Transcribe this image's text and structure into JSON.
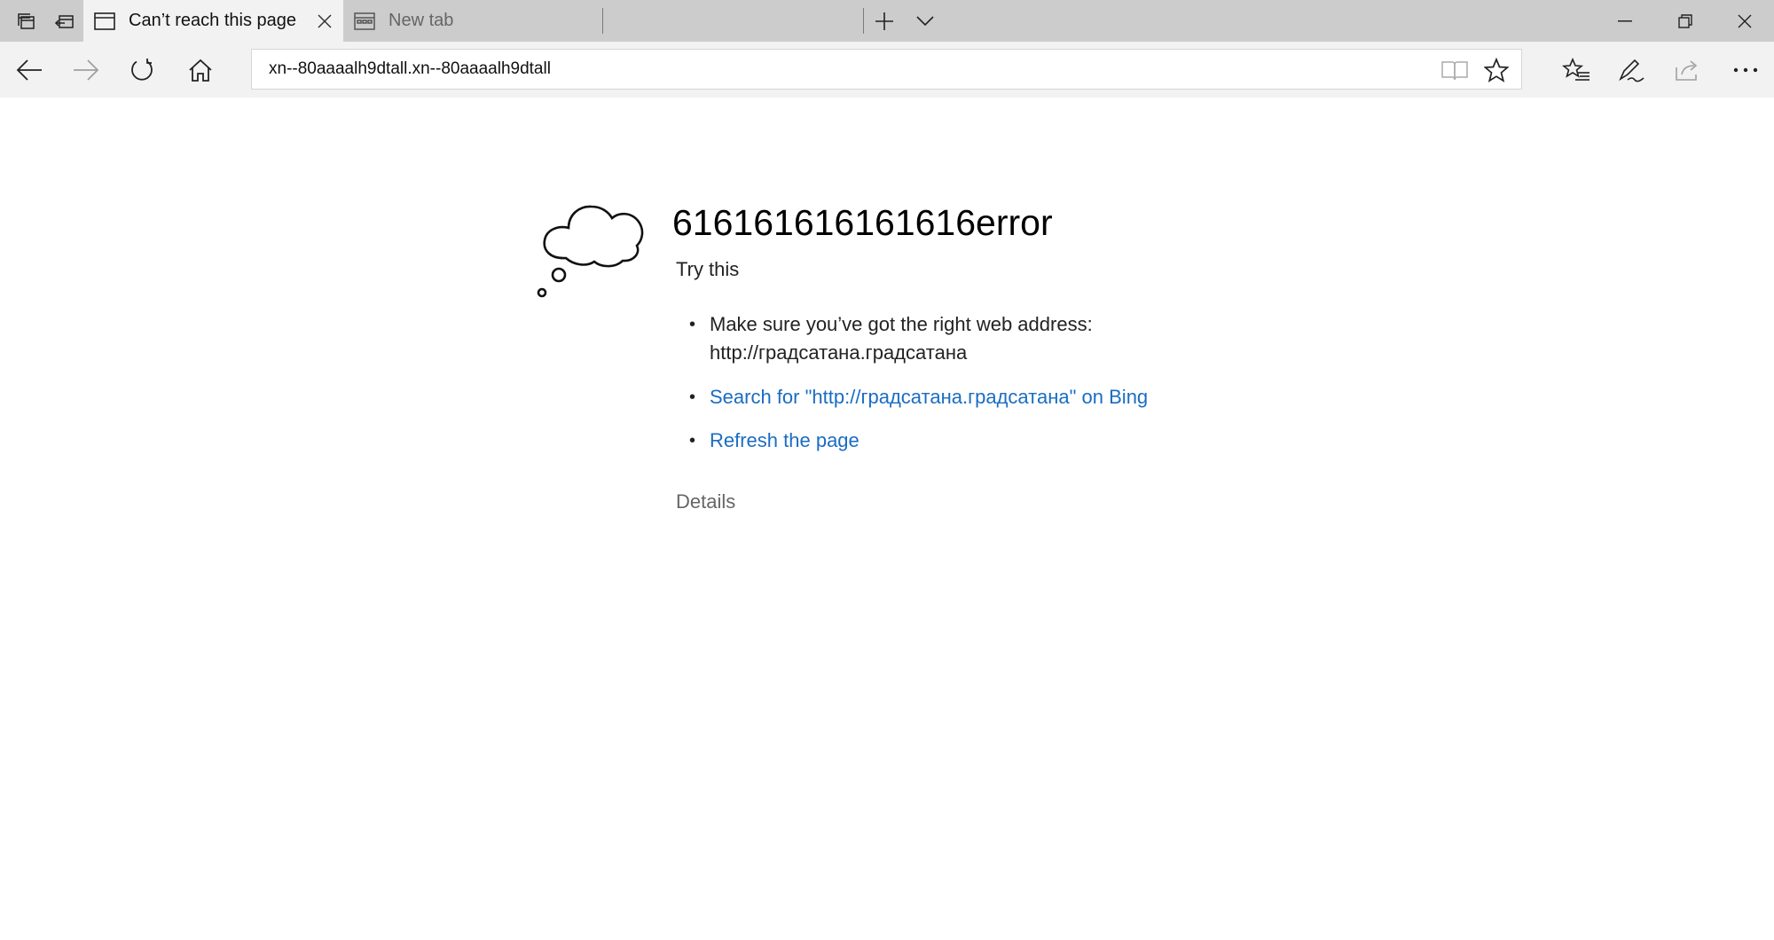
{
  "tabstrip": {
    "tabs": [
      {
        "title": "Can’t reach this page",
        "active": true,
        "icon": "page-icon"
      },
      {
        "title": "New tab",
        "active": false,
        "icon": "new-tab-page-icon"
      }
    ]
  },
  "navbar": {
    "address": "xn--80aaaalh9dtall.xn--80aaaalh9dtall"
  },
  "error_page": {
    "heading": "616161616161616error",
    "try_this": "Try this",
    "suggestion_address_line1": "Make sure you’ve got the right web address:",
    "suggestion_address_line2": "http://градсатана.градсатана",
    "search_link": "Search for \"http://градсатана.градсатана\" on Bing",
    "refresh_link": "Refresh the page",
    "details": "Details"
  },
  "colors": {
    "tabstrip_bg": "#cccccc",
    "active_tab_bg": "#f2f2f2",
    "link": "#1a6dc2"
  }
}
